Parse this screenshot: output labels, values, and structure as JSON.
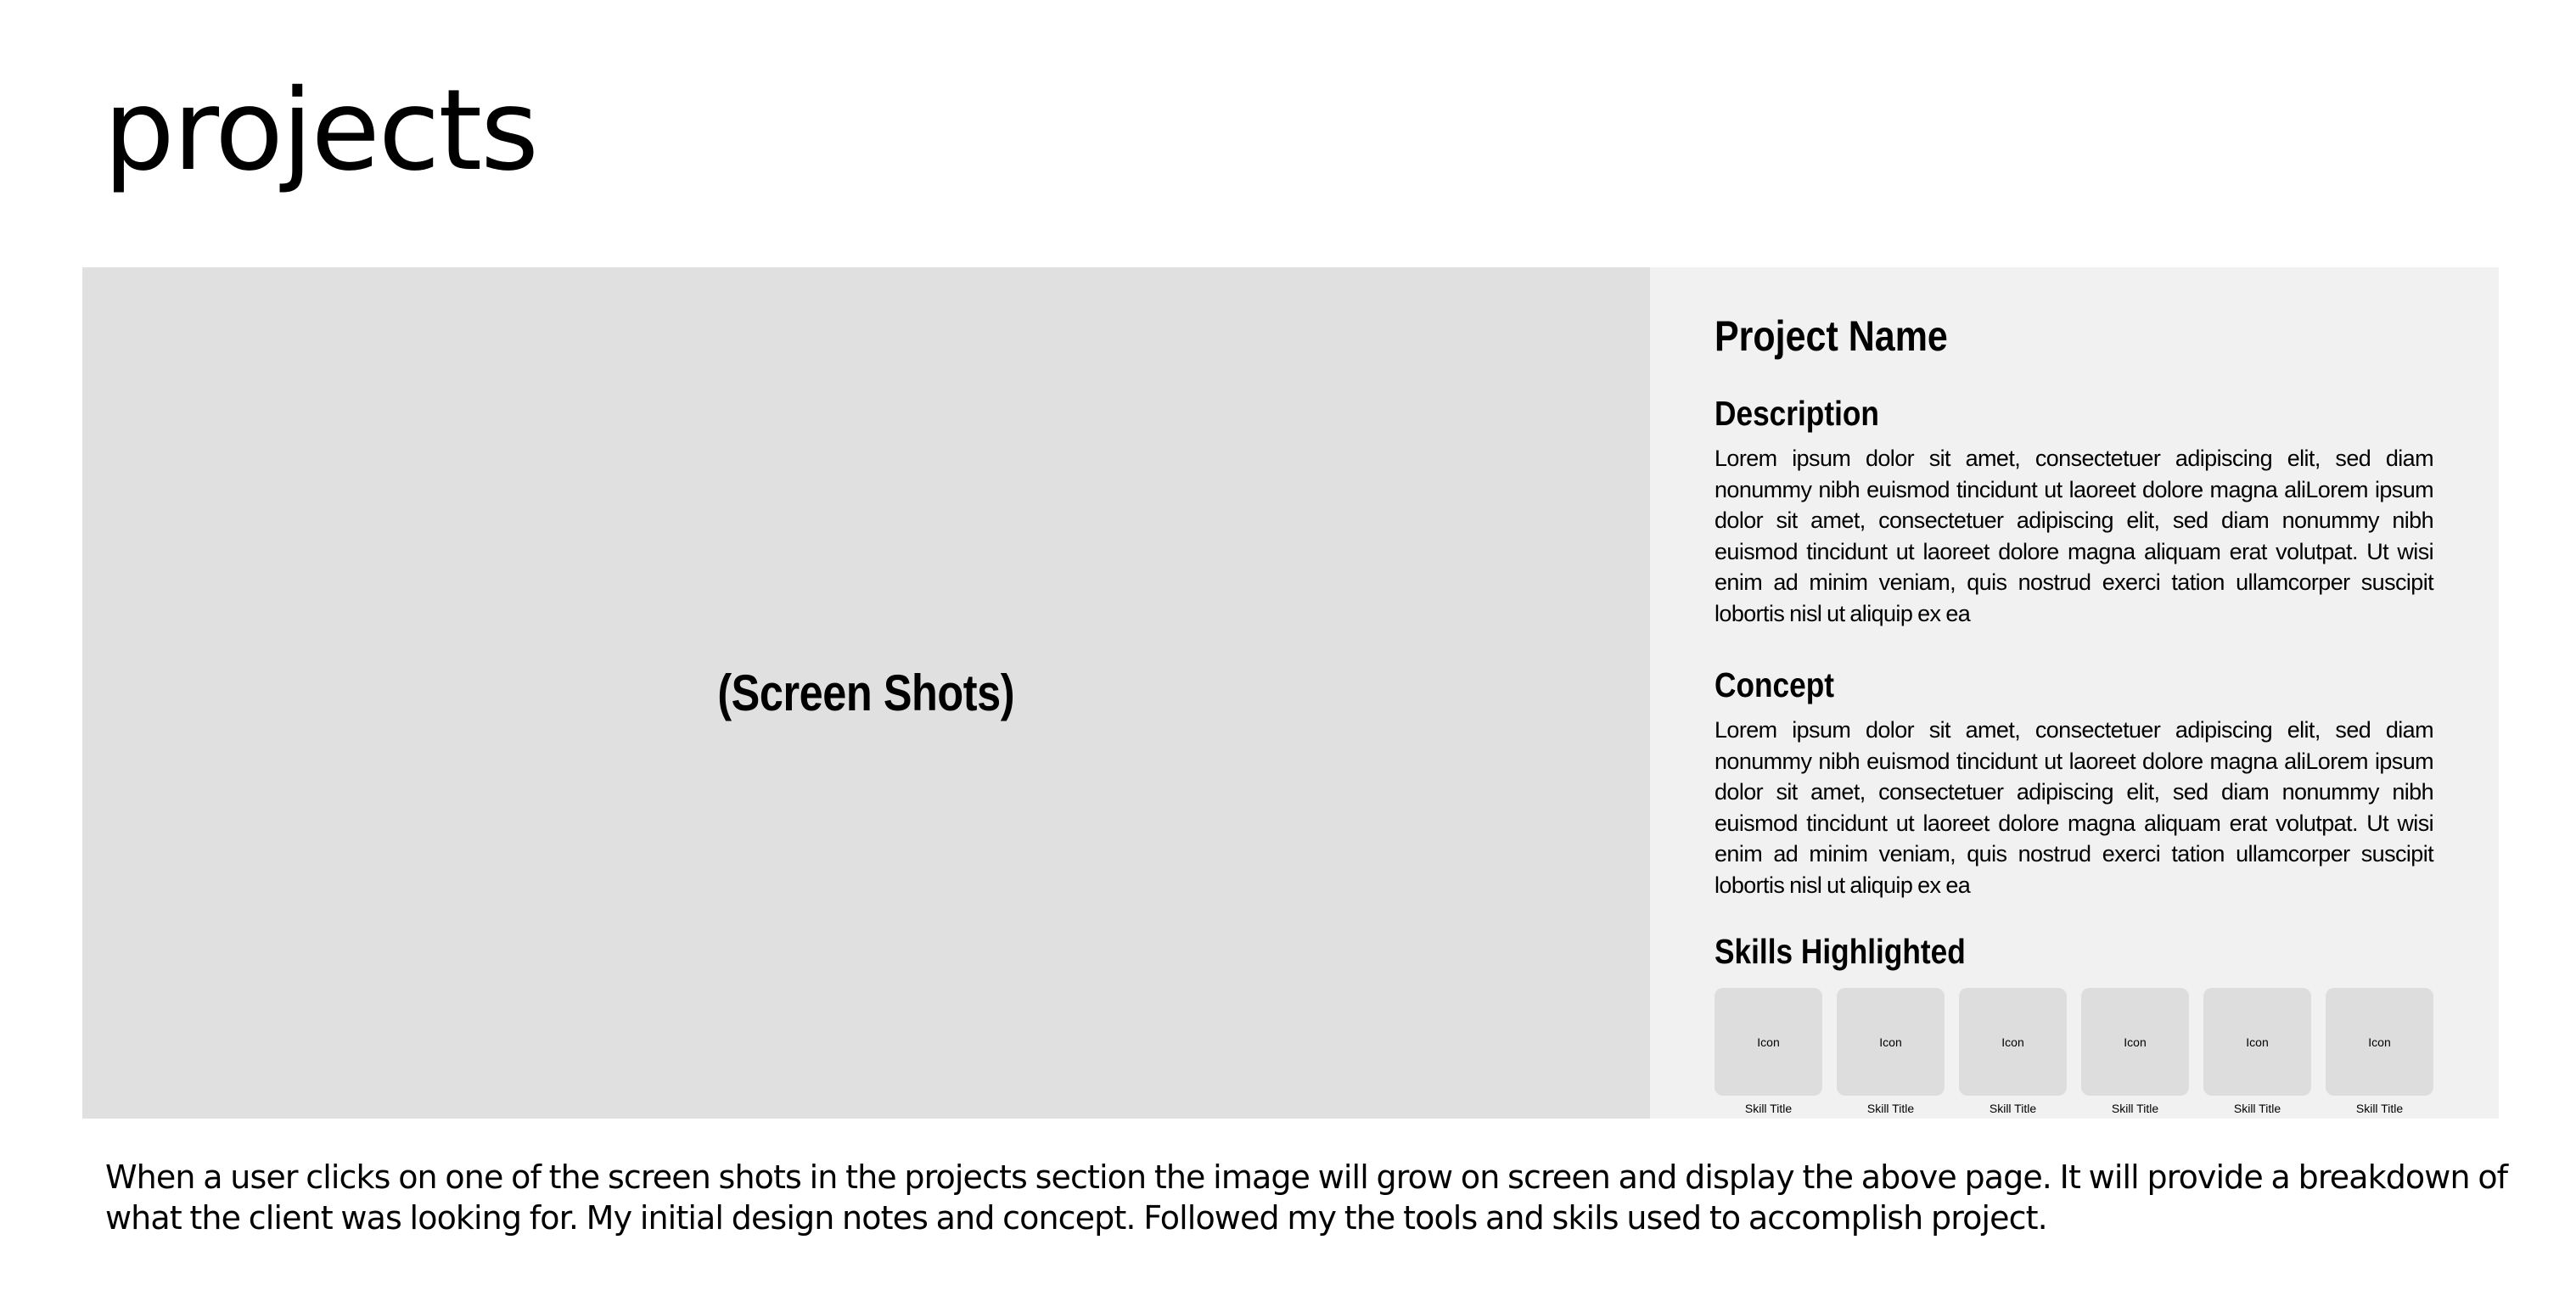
{
  "page": {
    "title": "projects"
  },
  "screenshot_area": {
    "label": "(Screen Shots)"
  },
  "details": {
    "project_name": "Project Name",
    "description": {
      "heading": "Description",
      "text": "Lorem ipsum dolor sit amet, consectetuer adipiscing elit, sed diam nonummy nibh euismod tincidunt ut laoreet dolore magna aliLorem ipsum dolor sit amet, consectetuer adipiscing elit, sed diam nonummy nibh euismod tincidunt ut laoreet dolore magna aliquam erat volutpat. Ut wisi enim ad minim veniam, quis nostrud exerci tation ullamcorper suscipit lobortis nisl ut aliquip ex ea"
    },
    "concept": {
      "heading": "Concept",
      "text": "Lorem ipsum dolor sit amet, consectetuer adipiscing elit, sed diam nonummy nibh euismod tincidunt ut laoreet dolore magna aliLorem ipsum dolor sit amet, consectetuer adipiscing elit, sed diam nonummy nibh euismod tincidunt ut laoreet dolore magna aliquam erat volutpat. Ut wisi enim ad minim veniam, quis nostrud exerci tation ullamcorper suscipit lobortis nisl ut aliquip ex ea"
    },
    "skills": {
      "heading": "Skills Highlighted",
      "items": [
        {
          "icon_label": "Icon",
          "title": "Skill Title"
        },
        {
          "icon_label": "Icon",
          "title": "Skill Title"
        },
        {
          "icon_label": "Icon",
          "title": "Skill Title"
        },
        {
          "icon_label": "Icon",
          "title": "Skill Title"
        },
        {
          "icon_label": "Icon",
          "title": "Skill Title"
        },
        {
          "icon_label": "Icon",
          "title": "Skill Title"
        }
      ]
    }
  },
  "note": "When a user clicks on one of the screen shots in the projects section the image will grow on screen and display the above page. It will provide a breakdown of what the client was looking for. My initial design notes and concept. Followed my the tools and skils used to accomplish project."
}
